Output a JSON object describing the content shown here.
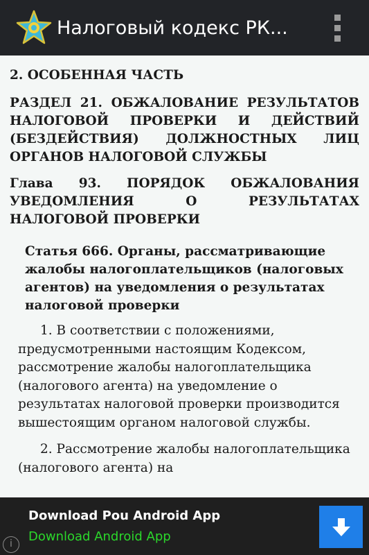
{
  "app": {
    "title": "Налоговый кодекс РК...",
    "icon": "star-emblem-icon",
    "menu_icon": "overflow-menu-icon"
  },
  "content": {
    "section": "2. ОСОБЕННАЯ ЧАСТЬ",
    "division": "РАЗДЕЛ 21. ОБЖАЛОВАНИЕ РЕЗУЛЬТАТОВ НАЛОГОВОЙ ПРОВЕРКИ И ДЕЙСТВИЙ (БЕЗДЕЙСТВИЯ) ДОЛЖНОСТНЫХ ЛИЦ ОРГАНОВ НАЛОГОВОЙ СЛУЖБЫ",
    "chapter": "Глава 93. ПОРЯДОК ОБЖАЛОВАНИЯ УВЕДОМЛЕНИЯ О РЕЗУЛЬТАТАХ НАЛОГОВОЙ ПРОВЕРКИ",
    "article": "Статья 666. Органы, рассматривающие жалобы налогоплательщиков (налоговых агентов) на уведомления о результатах налоговой проверки",
    "paragraphs": [
      "1. В соответствии с положениями, предусмотренными настоящим Кодексом, рассмотрение жалобы налогоплательщика (налогового агента) на уведомление о результатах налоговой проверки производится вышестоящим органом налоговой службы.",
      "2. Рассмотрение жалобы налогоплательщика (налогового агента) на"
    ]
  },
  "ad": {
    "title": "Download Pou Android App",
    "subtitle": "Download Android App",
    "info_glyph": "i",
    "info_icon": "info-icon",
    "download_icon": "download-arrow-icon"
  },
  "colors": {
    "action_bar": "#222428",
    "page_background": "#f4f7f6",
    "ad_background": "#1f1f1f",
    "ad_subtitle": "#2bd82b",
    "download_button": "#1f7fe8"
  }
}
